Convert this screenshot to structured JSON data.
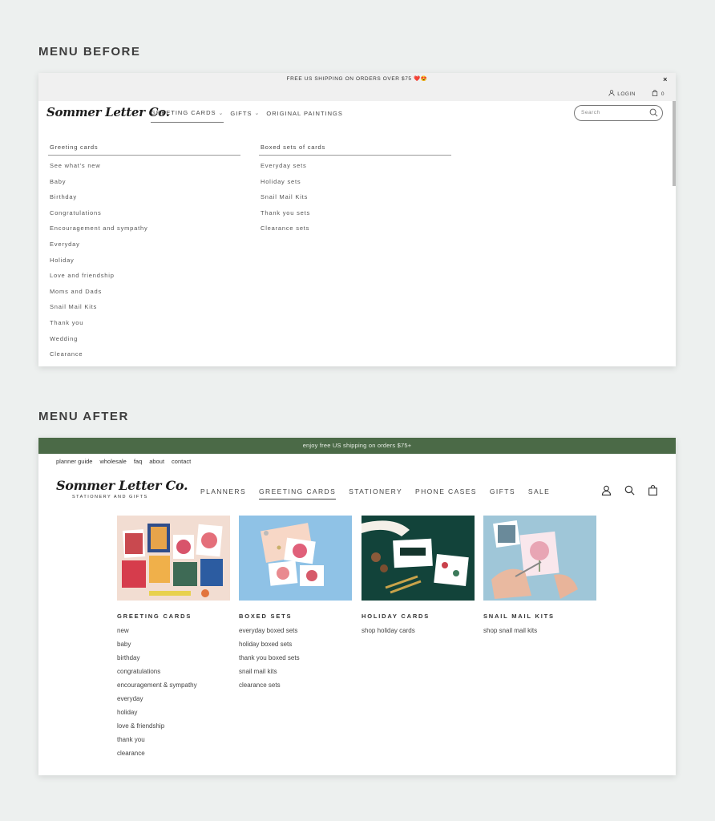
{
  "before": {
    "heading": "MENU BEFORE",
    "announcement": "FREE US SHIPPING ON ORDERS OVER $75 ❤️😍",
    "close": "×",
    "login": "LOGIN",
    "cart_count": "0",
    "logo": "Sommer Letter Co.",
    "nav": [
      "GREETING CARDS",
      "GIFTS",
      "ORIGINAL PAINTINGS"
    ],
    "search_placeholder": "Search",
    "columns": [
      {
        "heading": "Greeting cards",
        "links": [
          "See what's new",
          "Baby",
          "Birthday",
          "Congratulations",
          "Encouragement and sympathy",
          "Everyday",
          "Holiday",
          "Love and friendship",
          "Moms and Dads",
          "Snail Mail Kits",
          "Thank you",
          "Wedding",
          "Clearance"
        ]
      },
      {
        "heading": "Boxed sets of cards",
        "links": [
          "Everyday sets",
          "Holiday sets",
          "Snail Mail Kits",
          "Thank you sets",
          "Clearance sets"
        ]
      }
    ]
  },
  "after": {
    "heading": "MENU AFTER",
    "announcement": "enjoy free US shipping on orders $75+",
    "utility_links": [
      "planner guide",
      "wholesale",
      "faq",
      "about",
      "contact"
    ],
    "logo": "Sommer Letter Co.",
    "tagline": "STATIONERY AND GIFTS",
    "nav": [
      "PLANNERS",
      "GREETING CARDS",
      "STATIONERY",
      "PHONE CASES",
      "GIFTS",
      "SALE"
    ],
    "columns": [
      {
        "heading": "GREETING CARDS",
        "links": [
          "new",
          "baby",
          "birthday",
          "congratulations",
          "encouragement & sympathy",
          "everyday",
          "holiday",
          "love & friendship",
          "thank you",
          "clearance"
        ]
      },
      {
        "heading": "BOXED SETS",
        "links": [
          "everyday boxed sets",
          "holiday boxed sets",
          "thank you boxed sets",
          "snail mail kits",
          "clearance sets"
        ]
      },
      {
        "heading": "HOLIDAY CARDS",
        "links": [
          "shop holiday cards"
        ]
      },
      {
        "heading": "SNAIL MAIL KITS",
        "links": [
          "shop snail mail kits"
        ]
      }
    ]
  },
  "colors": {
    "page_bg": "#edf0ef",
    "announcement_green": "#4b6a47",
    "before_bar": "#f0f0f0"
  }
}
